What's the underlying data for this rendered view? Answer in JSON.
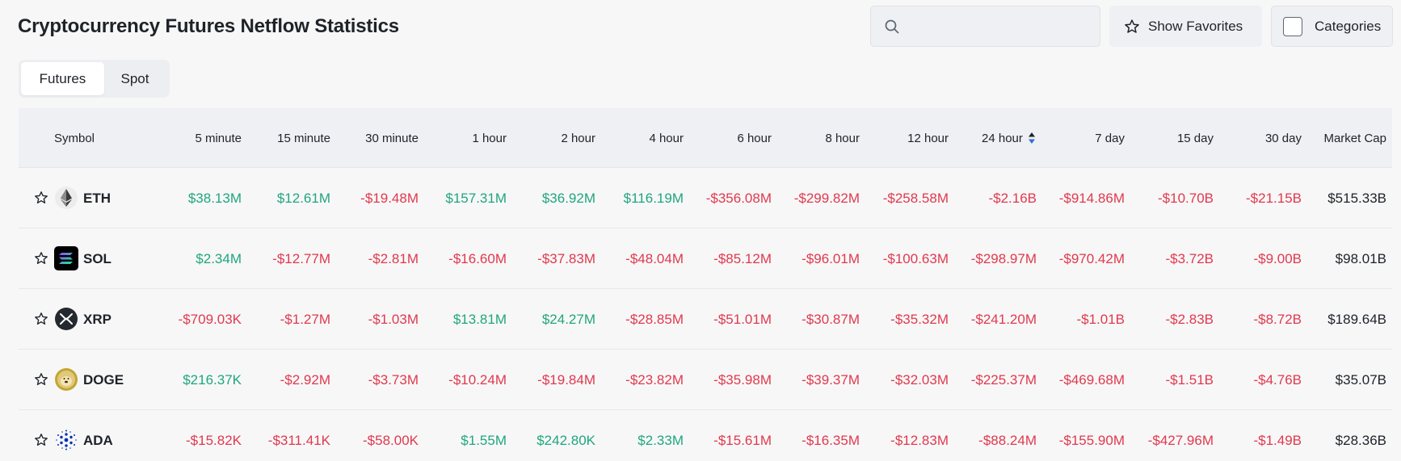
{
  "header": {
    "title": "Cryptocurrency Futures Netflow Statistics",
    "search_placeholder": "",
    "favorites_label": "Show Favorites",
    "categories_label": "Categories"
  },
  "tabs": [
    {
      "label": "Futures",
      "active": true
    },
    {
      "label": "Spot",
      "active": false
    }
  ],
  "table": {
    "columns": [
      "Symbol",
      "5 minute",
      "15 minute",
      "30 minute",
      "1 hour",
      "2 hour",
      "4 hour",
      "6 hour",
      "8 hour",
      "12 hour",
      "24 hour",
      "7 day",
      "15 day",
      "30 day",
      "Market Cap"
    ],
    "sorted_column": "24 hour",
    "rows": [
      {
        "symbol": "ETH",
        "icon": "eth-icon",
        "values": [
          "$38.13M",
          "$12.61M",
          "-$19.48M",
          "$157.31M",
          "$36.92M",
          "$116.19M",
          "-$356.08M",
          "-$299.82M",
          "-$258.58M",
          "-$2.16B",
          "-$914.86M",
          "-$10.70B",
          "-$21.15B"
        ],
        "market_cap": "$515.33B"
      },
      {
        "symbol": "SOL",
        "icon": "sol-icon",
        "values": [
          "$2.34M",
          "-$12.77M",
          "-$2.81M",
          "-$16.60M",
          "-$37.83M",
          "-$48.04M",
          "-$85.12M",
          "-$96.01M",
          "-$100.63M",
          "-$298.97M",
          "-$970.42M",
          "-$3.72B",
          "-$9.00B"
        ],
        "market_cap": "$98.01B"
      },
      {
        "symbol": "XRP",
        "icon": "xrp-icon",
        "values": [
          "-$709.03K",
          "-$1.27M",
          "-$1.03M",
          "$13.81M",
          "$24.27M",
          "-$28.85M",
          "-$51.01M",
          "-$30.87M",
          "-$35.32M",
          "-$241.20M",
          "-$1.01B",
          "-$2.83B",
          "-$8.72B"
        ],
        "market_cap": "$189.64B"
      },
      {
        "symbol": "DOGE",
        "icon": "doge-icon",
        "values": [
          "$216.37K",
          "-$2.92M",
          "-$3.73M",
          "-$10.24M",
          "-$19.84M",
          "-$23.82M",
          "-$35.98M",
          "-$39.37M",
          "-$32.03M",
          "-$225.37M",
          "-$469.68M",
          "-$1.51B",
          "-$4.76B"
        ],
        "market_cap": "$35.07B"
      },
      {
        "symbol": "ADA",
        "icon": "ada-icon",
        "values": [
          "-$15.82K",
          "-$311.41K",
          "-$58.00K",
          "$1.55M",
          "$242.80K",
          "$2.33M",
          "-$15.61M",
          "-$16.35M",
          "-$12.83M",
          "-$88.24M",
          "-$155.90M",
          "-$427.96M",
          "-$1.49B"
        ],
        "market_cap": "$28.36B"
      }
    ]
  },
  "colors": {
    "positive": "#20a67e",
    "negative": "#e0394e",
    "sort_active": "#2f6fd6"
  }
}
